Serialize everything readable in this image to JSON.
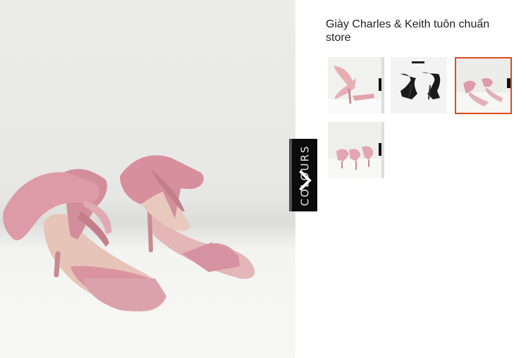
{
  "product": {
    "title": "Giày Charles & Keith tuôn chuẩn store",
    "colours_tab_label": "COLOURS"
  },
  "gallery": {
    "selected_index": 2,
    "thumbnails": [
      {
        "name": "thumb-pink-sandal-side",
        "color": "#e8b8b6"
      },
      {
        "name": "thumb-black-sandal",
        "color": "#1a1a1a"
      },
      {
        "name": "thumb-pink-sandal-pair",
        "color": "#e8b8b6"
      },
      {
        "name": "thumb-pink-sandal-floor",
        "color": "#e8b8b6"
      }
    ]
  },
  "colors": {
    "accent": "#e04a1f",
    "shoe_pink": "#d9a0a6",
    "tab_bg": "#0b0b0b"
  },
  "icons": {
    "next": "chevron-right-icon"
  }
}
